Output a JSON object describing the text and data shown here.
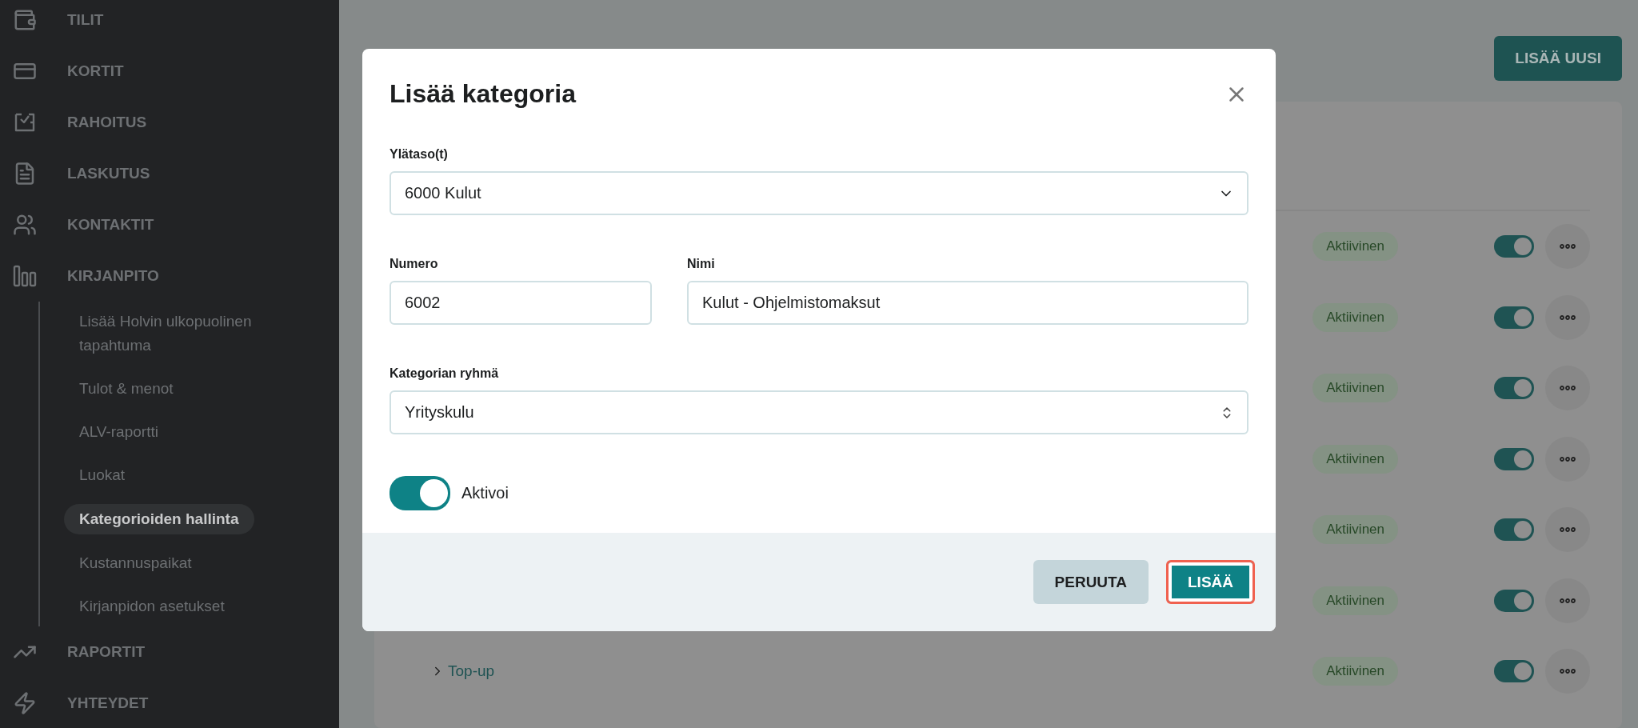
{
  "sidebar": {
    "items": [
      {
        "label": "TILIT"
      },
      {
        "label": "KORTIT"
      },
      {
        "label": "RAHOITUS"
      },
      {
        "label": "LASKUTUS"
      },
      {
        "label": "KONTAKTIT"
      },
      {
        "label": "KIRJANPITO",
        "children": [
          {
            "label": "Lisää Holvin ulkopuolinen tapahtuma",
            "selected": false
          },
          {
            "label": "Tulot & menot",
            "selected": false
          },
          {
            "label": "ALV-raportti",
            "selected": false
          },
          {
            "label": "Luokat",
            "selected": false
          },
          {
            "label": "Kategorioiden hallinta",
            "selected": true
          },
          {
            "label": "Kustannuspaikat",
            "selected": false
          },
          {
            "label": "Kirjanpidon asetukset",
            "selected": false
          }
        ]
      },
      {
        "label": "RAPORTIT"
      },
      {
        "label": "YHTEYDET"
      }
    ]
  },
  "page": {
    "add_button": "LISÄÄ UUSI",
    "rows": [
      {
        "status": "Aktiivinen",
        "on": true
      },
      {
        "status": "Aktiivinen",
        "on": true
      },
      {
        "status": "Aktiivinen",
        "on": true
      },
      {
        "status": "Aktiivinen",
        "on": true
      },
      {
        "status": "Aktiivinen",
        "on": true
      },
      {
        "status": "Aktiivinen",
        "on": true
      },
      {
        "label": "Top-up",
        "status": "Aktiivinen",
        "on": true
      }
    ]
  },
  "modal": {
    "title": "Lisää kategoria",
    "field_rows": [
      [
        {
          "kind": "dropdown",
          "label": "Ylätaso(t)",
          "value": "6000 Kulut"
        }
      ],
      [
        {
          "kind": "text",
          "label": "Numero",
          "value": "6002"
        },
        {
          "kind": "text",
          "label": "Nimi",
          "value": "Kulut - Ohjelmistomaksut"
        }
      ],
      [
        {
          "kind": "stepper",
          "label": "Kategorian ryhmä",
          "value": "Yrityskulu"
        }
      ]
    ],
    "toggle": {
      "label": "Aktivoi",
      "on": true
    },
    "buttons": [
      {
        "label": "PERUUTA",
        "kind": "secondary",
        "focused": false
      },
      {
        "label": "LISÄÄ",
        "kind": "primary",
        "focused": true
      }
    ]
  }
}
